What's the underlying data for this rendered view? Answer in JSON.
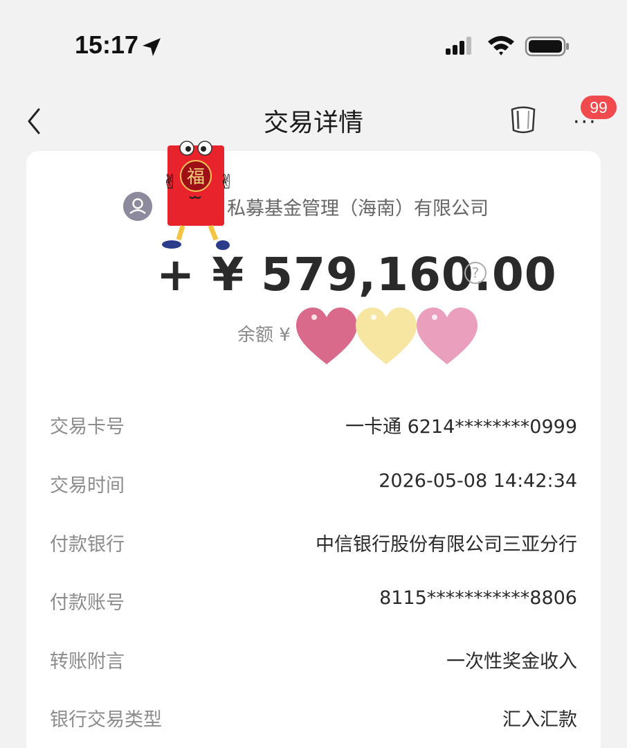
{
  "status_bar": {
    "time": "15:17"
  },
  "nav": {
    "title": "交易详情",
    "badge_count": "99",
    "more_label": "···"
  },
  "transaction": {
    "payer_name": "私募基金管理（海南）有限公司",
    "sticker_text": "福",
    "amount": "+ ¥ 579,160.00",
    "balance_label": "余额 ¥"
  },
  "details": [
    {
      "label": "交易卡号",
      "value": "一卡通 6214********0999"
    },
    {
      "label": "交易时间",
      "value": "2026-05-08 14:42:34"
    },
    {
      "label": "付款银行",
      "value": "中信银行股份有限公司三亚分行"
    },
    {
      "label": "付款账号",
      "value": "8115***********8806"
    },
    {
      "label": "转账附言",
      "value": "一次性奖金收入"
    },
    {
      "label": "银行交易类型",
      "value": "汇入汇款"
    }
  ],
  "colors": {
    "badge": "#f04a4f",
    "envelope": "#e8232b",
    "heart_pink": "#d96a8c",
    "heart_yellow": "#f6e6a2",
    "heart_light_pink": "#ea9fbd"
  },
  "icons": [
    "location-arrow-icon",
    "signal-icon",
    "wifi-icon",
    "battery-icon",
    "back-icon",
    "cup-icon",
    "help-icon",
    "avatar-icon"
  ]
}
